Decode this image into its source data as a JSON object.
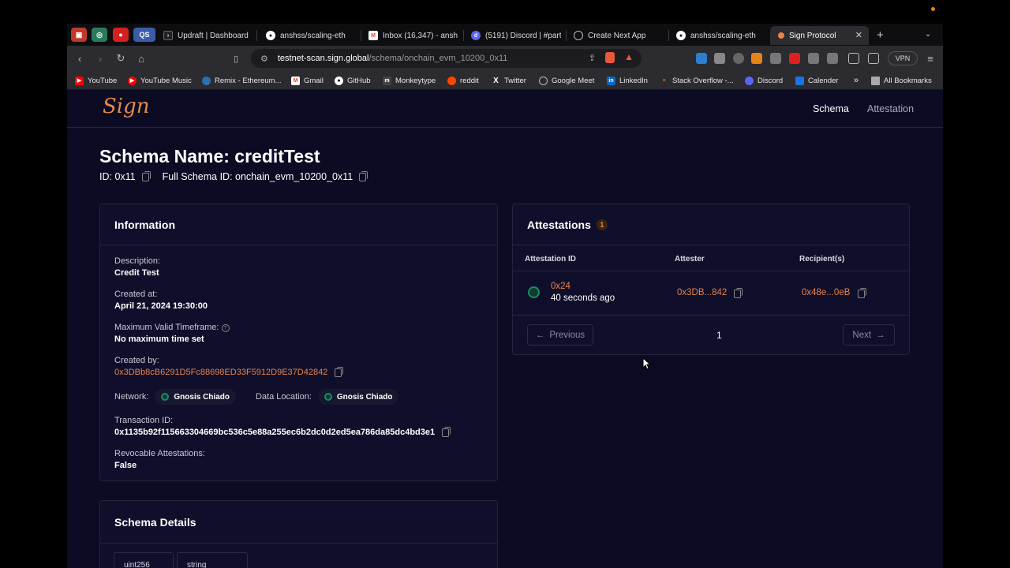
{
  "browser": {
    "tabs": [
      {
        "label": "Updraft | Dashboard",
        "icon": "updraft-icon"
      },
      {
        "label": "anshss/scaling-eth",
        "icon": "github-icon"
      },
      {
        "label": "Inbox (16,347) - ansh",
        "icon": "gmail-icon"
      },
      {
        "label": "(5191) Discord | #parti",
        "icon": "discord-icon"
      },
      {
        "label": "Create Next App",
        "icon": "globe-icon"
      },
      {
        "label": "anshss/scaling-eth",
        "icon": "github-icon"
      },
      {
        "label": "Sign Protocol",
        "icon": "sign-icon"
      }
    ],
    "pinned_label": "QS",
    "url_host": "testnet-scan.sign.global",
    "url_path": "/schema/onchain_evm_10200_0x11",
    "vpn_label": "VPN",
    "bookmarks": [
      {
        "label": "YouTube",
        "color": "#ff0000"
      },
      {
        "label": "YouTube Music",
        "color": "#ff0000"
      },
      {
        "label": "Remix - Ethereum...",
        "color": "#2a6fb0"
      },
      {
        "label": "Gmail",
        "color": "#ea4335"
      },
      {
        "label": "GitHub",
        "color": "#444444"
      },
      {
        "label": "Monkeytype",
        "color": "#444444"
      },
      {
        "label": "reddit",
        "color": "#ff4500"
      },
      {
        "label": "Twitter",
        "color": "#222222"
      },
      {
        "label": "Google Meet",
        "color": "#555555"
      },
      {
        "label": "LinkedIn",
        "color": "#0a66c2"
      },
      {
        "label": "Stack Overflow -...",
        "color": "#f48024"
      },
      {
        "label": "Discord",
        "color": "#5865f2"
      },
      {
        "label": "Calender",
        "color": "#1a73e8"
      }
    ],
    "bookmarks_overflow": "»",
    "all_bookmarks": "All Bookmarks"
  },
  "site": {
    "logo": "Sign",
    "nav": {
      "schema": "Schema",
      "attestation": "Attestation"
    }
  },
  "schema": {
    "title": "Schema Name: creditTest",
    "id_label": "ID: 0x11",
    "full_id_label": "Full Schema ID: onchain_evm_10200_0x11"
  },
  "information": {
    "heading": "Information",
    "description_label": "Description:",
    "description": "Credit Test",
    "created_at_label": "Created at:",
    "created_at": "April 21, 2024 19:30:00",
    "timeframe_label": "Maximum Valid Timeframe:",
    "timeframe": "No maximum time set",
    "created_by_label": "Created by:",
    "created_by": "0x3DBb8cB6291D5Fc88698ED33F5912D9E37D42842",
    "network_label": "Network:",
    "network": "Gnosis Chiado",
    "data_location_label": "Data Location:",
    "data_location": "Gnosis Chiado",
    "tx_label": "Transaction ID:",
    "tx_id": "0x1135b92f115663304669bc536c5e88a255ec6b2dc0d2ed5ea786da85dc4bd3e1",
    "revocable_label": "Revocable Attestations:",
    "revocable": "False"
  },
  "attestations": {
    "heading": "Attestations",
    "count": "1",
    "columns": {
      "id": "Attestation ID",
      "attester": "Attester",
      "recipients": "Recipient(s)"
    },
    "rows": [
      {
        "id": "0x24",
        "time": "40 seconds ago",
        "attester": "0x3DB...842",
        "recipient": "0x48e...0eB"
      }
    ],
    "prev_label": "Previous",
    "next_label": "Next",
    "page": "1"
  },
  "schema_details": {
    "heading": "Schema Details",
    "types": [
      "uint256",
      "string"
    ]
  }
}
